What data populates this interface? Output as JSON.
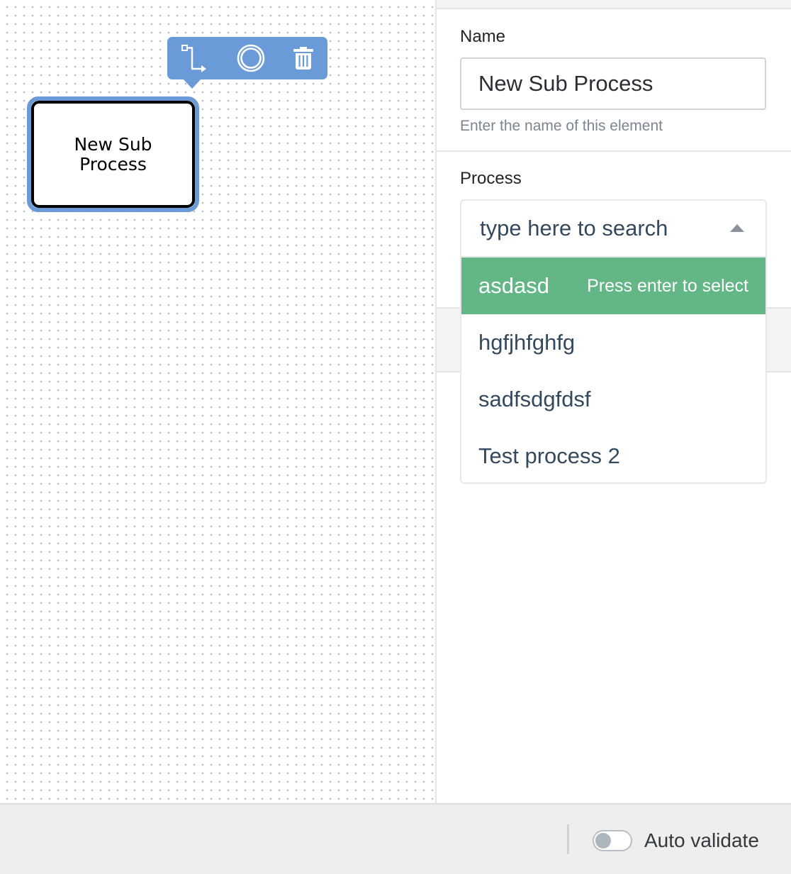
{
  "canvas": {
    "task": {
      "label": "New Sub Process"
    },
    "context_pad": {
      "items": [
        {
          "name": "connect-icon"
        },
        {
          "name": "boundary-event-icon"
        },
        {
          "name": "trash-icon"
        }
      ]
    }
  },
  "inspector": {
    "name_field": {
      "label": "Name",
      "value": "New Sub Process",
      "help": "Enter the name of this element"
    },
    "process_field": {
      "label": "Process",
      "placeholder": "type here to search",
      "options": [
        {
          "label": "asdasd",
          "highlighted": true,
          "hint": "Press enter to select"
        },
        {
          "label": "hgfjhfghfg",
          "highlighted": false
        },
        {
          "label": "sadfsdgfdsf",
          "highlighted": false
        },
        {
          "label": "Test process 2",
          "highlighted": false
        }
      ]
    }
  },
  "footer": {
    "auto_validate_label": "Auto validate",
    "auto_validate_on": false
  },
  "colors": {
    "selection": "#6a9ad8",
    "option_highlight": "#63b685",
    "text": "#35495e"
  }
}
